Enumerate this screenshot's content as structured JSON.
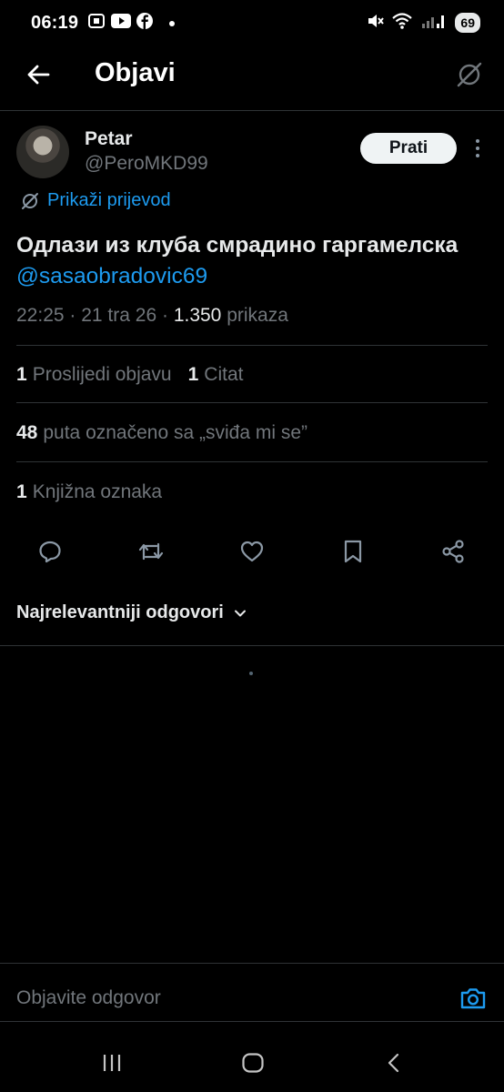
{
  "status_bar": {
    "time": "06:19",
    "battery": "69",
    "icons_left": [
      "screenshot-icon",
      "youtube-icon",
      "facebook-icon",
      "dot-icon"
    ],
    "icons_right": [
      "mute-icon",
      "wifi-icon",
      "signal-icon"
    ]
  },
  "header": {
    "title": "Objavi",
    "back_icon": "arrow-left-icon",
    "right_icon": "translate-off-icon"
  },
  "author": {
    "name": "Petar",
    "handle": "@PeroMKD99",
    "follow_label": "Prati"
  },
  "translate_label": "Prikaži prijevod",
  "tweet": {
    "text": "Одлази из клуба смрадино гаргамелска",
    "mention": "@sasaobradovic69",
    "time": "22:25",
    "date": "21 tra 26",
    "views_count": "1.350",
    "views_label": "prikaza"
  },
  "stats": {
    "reposts_count": "1",
    "reposts_label": "Proslijedi objavu",
    "quotes_count": "1",
    "quotes_label": "Citat",
    "likes_count": "48",
    "likes_label": "puta označeno sa „sviđa mi se”",
    "bookmarks_count": "1",
    "bookmarks_label": "Knjižna oznaka"
  },
  "actions": [
    "reply-icon",
    "repost-icon",
    "like-icon",
    "bookmark-icon",
    "share-icon"
  ],
  "replies": {
    "sort_label": "Najrelevantniji odgovori"
  },
  "composer": {
    "placeholder": "Objavite odgovor",
    "camera_icon": "camera-icon"
  },
  "nav": [
    "recents-icon",
    "home-icon",
    "back-icon"
  ],
  "colors": {
    "background": "#000000",
    "accent": "#1d9bf0",
    "text": "#e7e9ea",
    "secondary": "#71767b",
    "divider": "#2f3336"
  }
}
